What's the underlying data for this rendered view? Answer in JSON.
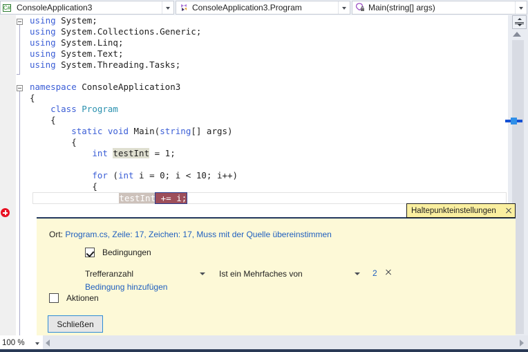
{
  "navbar": {
    "project": {
      "label": "ConsoleApplication3",
      "icon": "csharp-project-icon"
    },
    "class": {
      "label": "ConsoleApplication3.Program",
      "icon": "class-icon"
    },
    "member": {
      "label": "Main(string[] args)",
      "icon": "method-private-icon"
    }
  },
  "code": {
    "lines": [
      {
        "indent": 0,
        "tokens": [
          {
            "t": "using ",
            "c": "kw"
          },
          {
            "t": "System;",
            "c": "pl"
          }
        ]
      },
      {
        "indent": 0,
        "tokens": [
          {
            "t": "using ",
            "c": "kw"
          },
          {
            "t": "System.Collections.Generic;",
            "c": "pl"
          }
        ]
      },
      {
        "indent": 0,
        "tokens": [
          {
            "t": "using ",
            "c": "kw"
          },
          {
            "t": "System.Linq;",
            "c": "pl"
          }
        ]
      },
      {
        "indent": 0,
        "tokens": [
          {
            "t": "using ",
            "c": "kw"
          },
          {
            "t": "System.Text;",
            "c": "pl"
          }
        ]
      },
      {
        "indent": 0,
        "tokens": [
          {
            "t": "using ",
            "c": "kw"
          },
          {
            "t": "System.Threading.Tasks;",
            "c": "pl"
          }
        ]
      },
      {
        "indent": 0,
        "tokens": []
      },
      {
        "indent": 0,
        "tokens": [
          {
            "t": "namespace ",
            "c": "kw"
          },
          {
            "t": "ConsoleApplication3",
            "c": "pl"
          }
        ]
      },
      {
        "indent": 0,
        "tokens": [
          {
            "t": "{",
            "c": "pl"
          }
        ]
      },
      {
        "indent": 1,
        "tokens": [
          {
            "t": "class ",
            "c": "kw"
          },
          {
            "t": "Program",
            "c": "type"
          }
        ]
      },
      {
        "indent": 1,
        "tokens": [
          {
            "t": "{",
            "c": "pl"
          }
        ]
      },
      {
        "indent": 2,
        "tokens": [
          {
            "t": "static ",
            "c": "kw"
          },
          {
            "t": "void ",
            "c": "kw"
          },
          {
            "t": "Main(",
            "c": "pl"
          },
          {
            "t": "string",
            "c": "kw"
          },
          {
            "t": "[] args)",
            "c": "pl"
          }
        ]
      },
      {
        "indent": 2,
        "tokens": [
          {
            "t": "{",
            "c": "pl"
          }
        ]
      },
      {
        "indent": 3,
        "tokens": [
          {
            "t": "int ",
            "c": "kw"
          },
          {
            "t": "testInt",
            "c": "hl-ref"
          },
          {
            "t": " = 1;",
            "c": "pl"
          }
        ]
      },
      {
        "indent": 3,
        "tokens": []
      },
      {
        "indent": 3,
        "tokens": [
          {
            "t": "for ",
            "c": "kw"
          },
          {
            "t": "(",
            "c": "pl"
          },
          {
            "t": "int",
            "c": "kw"
          },
          {
            "t": " i = 0; i < 10; i++)",
            "c": "pl"
          }
        ]
      },
      {
        "indent": 3,
        "tokens": [
          {
            "t": "{",
            "c": "pl"
          }
        ]
      }
    ],
    "breakpoint_line": {
      "indent": 4,
      "token_a": "testInt",
      "token_b": " += i;"
    }
  },
  "breakpoint_settings": {
    "title": "Haltepunkteinstellungen",
    "close_icon": "close-icon",
    "location_label": "Ort:",
    "location_value": "Program.cs, Zeile: 17, Zeichen: 17, Muss mit der Quelle übereinstimmen",
    "conditions_checkbox": {
      "label": "Bedingungen",
      "checked": true
    },
    "condition_row": {
      "type": "Trefferanzahl",
      "comparison": "Ist ein Mehrfaches von",
      "value": "2",
      "remove_icon": "close-icon"
    },
    "add_condition_link": "Bedingung hinzufügen",
    "actions_checkbox": {
      "label": "Aktionen",
      "checked": false
    },
    "close_button": "Schließen"
  },
  "statusbar": {
    "zoom": "100 %"
  },
  "colors": {
    "panel_bg": "#fdf9d7",
    "title_bg": "#faefa0",
    "keyword": "#3b5ed6",
    "type": "#2b91af",
    "link": "#1f5fbf",
    "breakpoint_red": "#e81123",
    "accent_border": "#21375e"
  }
}
